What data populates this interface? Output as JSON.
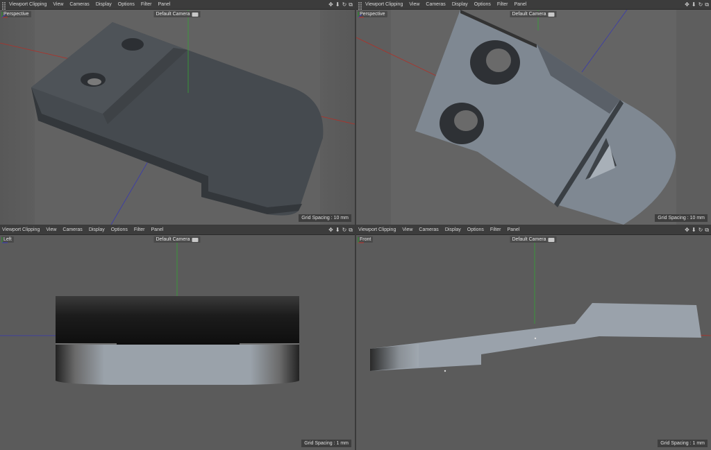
{
  "menu": [
    "Viewport Clipping",
    "View",
    "Cameras",
    "Display",
    "Options",
    "Filter",
    "Panel"
  ],
  "nav_icons": [
    "move-icon",
    "down-arrow-icon",
    "rotate-icon",
    "maximize-icon"
  ],
  "camera": "Default Camera",
  "views": [
    {
      "name": "Perspective",
      "grid": "Grid Spacing : 10 mm"
    },
    {
      "name": "Perspective",
      "grid": "Grid Spacing : 10 mm"
    },
    {
      "name": "Left",
      "grid": "Grid Spacing : 1 mm"
    },
    {
      "name": "Front",
      "grid": "Grid Spacing : 1 mm"
    }
  ],
  "colors": {
    "x_axis": "#c0302c",
    "y_axis": "#34a534",
    "z_axis": "#3a3ab8",
    "viewport_bg": "#5b5b5b"
  }
}
